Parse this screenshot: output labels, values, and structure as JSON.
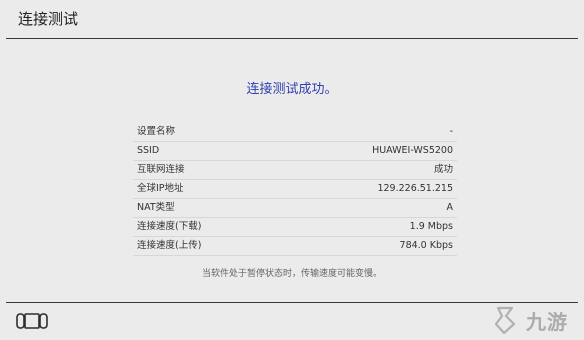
{
  "header": {
    "title": "连接测试"
  },
  "main": {
    "success_message": "连接测试成功。",
    "rows": [
      {
        "label": "设置名称",
        "value": "-"
      },
      {
        "label": "SSID",
        "value": "HUAWEI-WS5200"
      },
      {
        "label": "互联网连接",
        "value": "成功"
      },
      {
        "label": "全球IP地址",
        "value": "129.226.51.215"
      },
      {
        "label": "NAT类型",
        "value": "A"
      },
      {
        "label": "连接速度(下载)",
        "value": "1.9 Mbps"
      },
      {
        "label": "连接速度(上传)",
        "value": "784.0 Kbps"
      }
    ],
    "note": "当软件处于暂停状态时，传输速度可能变慢。"
  },
  "footer": {
    "device_icon": "console-icon",
    "watermark_text": "九游"
  }
}
